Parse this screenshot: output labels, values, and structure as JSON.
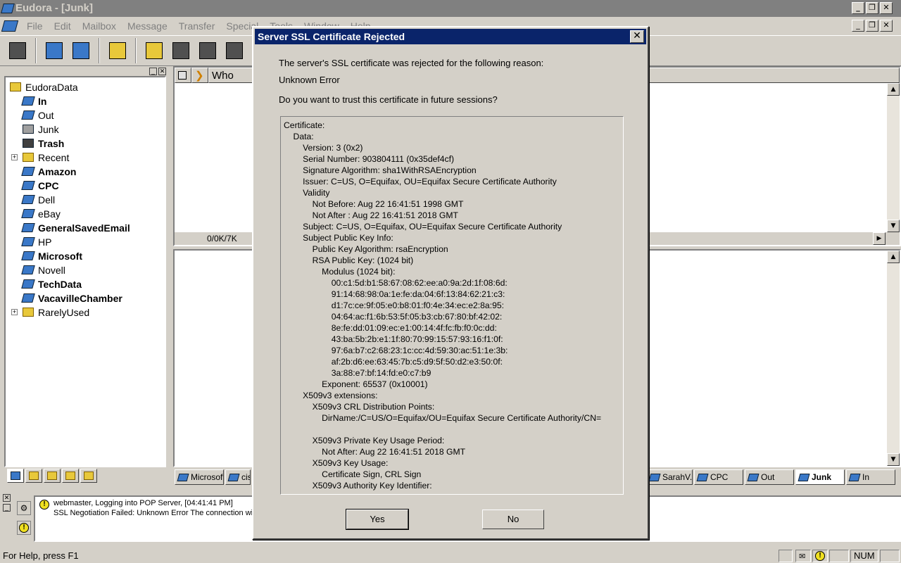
{
  "window": {
    "title": "Eudora - [Junk]"
  },
  "menu": [
    "File",
    "Edit",
    "Mailbox",
    "Message",
    "Transfer",
    "Special",
    "Tools",
    "Window",
    "Help"
  ],
  "folders": [
    {
      "label": "EudoraData",
      "bold": false,
      "icon": "folder-icon",
      "indent": 0
    },
    {
      "label": "In",
      "bold": true,
      "icon": "inbox-icon",
      "indent": 1
    },
    {
      "label": "Out",
      "bold": false,
      "icon": "outbox-icon",
      "indent": 1
    },
    {
      "label": "Junk",
      "bold": false,
      "icon": "junk-icon",
      "indent": 1
    },
    {
      "label": "Trash",
      "bold": true,
      "icon": "trash-icon",
      "indent": 1
    },
    {
      "label": "Recent",
      "bold": false,
      "icon": "folder-icon",
      "indent": 1,
      "expander": "+"
    },
    {
      "label": "Amazon",
      "bold": true,
      "icon": "mailbox-icon",
      "indent": 1
    },
    {
      "label": "CPC",
      "bold": true,
      "icon": "mailbox-icon",
      "indent": 1
    },
    {
      "label": "Dell",
      "bold": false,
      "icon": "mailbox-icon",
      "indent": 1
    },
    {
      "label": "eBay",
      "bold": false,
      "icon": "mailbox-icon",
      "indent": 1
    },
    {
      "label": "GeneralSavedEmail",
      "bold": true,
      "icon": "mailbox-icon",
      "indent": 1
    },
    {
      "label": "HP",
      "bold": false,
      "icon": "mailbox-icon",
      "indent": 1
    },
    {
      "label": "Microsoft",
      "bold": true,
      "icon": "mailbox-icon",
      "indent": 1
    },
    {
      "label": "Novell",
      "bold": false,
      "icon": "mailbox-icon",
      "indent": 1
    },
    {
      "label": "TechData",
      "bold": true,
      "icon": "mailbox-icon",
      "indent": 1
    },
    {
      "label": "VacavilleChamber",
      "bold": true,
      "icon": "mailbox-icon",
      "indent": 1
    },
    {
      "label": "RarelyUsed",
      "bold": false,
      "icon": "folder-icon",
      "indent": 1,
      "expander": "+"
    }
  ],
  "list": {
    "header_who": "Who",
    "size_status": "0/0K/7K"
  },
  "mailbox_tabs": {
    "left": [
      "Microsoft",
      "cis"
    ],
    "right": [
      {
        "label": "SarahV...",
        "active": false
      },
      {
        "label": "CPC",
        "active": false
      },
      {
        "label": "Out",
        "active": false
      },
      {
        "label": "Junk",
        "active": true
      },
      {
        "label": "In",
        "active": false
      }
    ]
  },
  "tasks": {
    "line1": "webmaster, Logging into POP Server, [04:41:41 PM]",
    "line2": "SSL Negotiation Failed: Unknown Error  The connection wit"
  },
  "statusbar": {
    "help": "For Help, press F1",
    "num": "NUM"
  },
  "dialog": {
    "title": "Server SSL Certificate Rejected",
    "close_label": "✕",
    "reason_intro": "The server's SSL certificate was rejected for the following reason:",
    "reason": "Unknown Error",
    "question": "Do you want to trust this certificate in future sessions?",
    "certificate_lines": [
      "Certificate:",
      "    Data:",
      "        Version: 3 (0x2)",
      "        Serial Number: 903804111 (0x35def4cf)",
      "        Signature Algorithm: sha1WithRSAEncryption",
      "        Issuer: C=US, O=Equifax, OU=Equifax Secure Certificate Authority",
      "        Validity",
      "            Not Before: Aug 22 16:41:51 1998 GMT",
      "            Not After : Aug 22 16:41:51 2018 GMT",
      "        Subject: C=US, O=Equifax, OU=Equifax Secure Certificate Authority",
      "        Subject Public Key Info:",
      "            Public Key Algorithm: rsaEncryption",
      "            RSA Public Key: (1024 bit)",
      "                Modulus (1024 bit):",
      "                    00:c1:5d:b1:58:67:08:62:ee:a0:9a:2d:1f:08:6d:",
      "                    91:14:68:98:0a:1e:fe:da:04:6f:13:84:62:21:c3:",
      "                    d1:7c:ce:9f:05:e0:b8:01:f0:4e:34:ec:e2:8a:95:",
      "                    04:64:ac:f1:6b:53:5f:05:b3:cb:67:80:bf:42:02:",
      "                    8e:fe:dd:01:09:ec:e1:00:14:4f:fc:fb:f0:0c:dd:",
      "                    43:ba:5b:2b:e1:1f:80:70:99:15:57:93:16:f1:0f:",
      "                    97:6a:b7:c2:68:23:1c:cc:4d:59:30:ac:51:1e:3b:",
      "                    af:2b:d6:ee:63:45:7b:c5:d9:5f:50:d2:e3:50:0f:",
      "                    3a:88:e7:bf:14:fd:e0:c7:b9",
      "                Exponent: 65537 (0x10001)",
      "        X509v3 extensions:",
      "            X509v3 CRL Distribution Points:",
      "                DirName:/C=US/O=Equifax/OU=Equifax Secure Certificate Authority/CN=",
      "",
      "            X509v3 Private Key Usage Period:",
      "                Not After: Aug 22 16:41:51 2018 GMT",
      "            X509v3 Key Usage:",
      "                Certificate Sign, CRL Sign",
      "            X509v3 Authority Key Identifier:"
    ],
    "yes_label": "Yes",
    "no_label": "No"
  }
}
